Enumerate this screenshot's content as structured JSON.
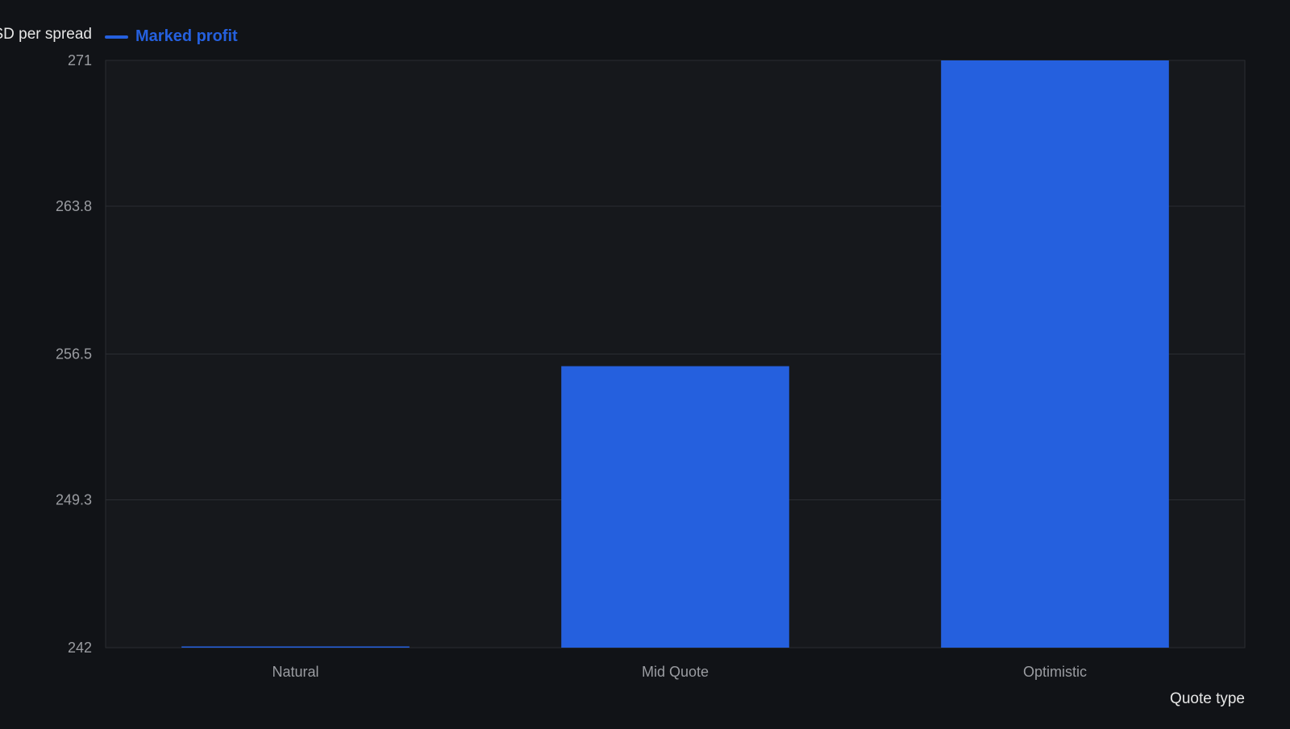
{
  "colors": {
    "background": "#111317",
    "plot_background": "#16181c",
    "bar": "#2560de",
    "grid": "#2a2d32",
    "axis_text": "#9a9ca1",
    "label_text": "#e6e6e6"
  },
  "chart_data": {
    "type": "bar",
    "ylabel": "USD per spread",
    "xlabel": "Quote type",
    "categories": [
      "Natural",
      "Mid Quote",
      "Optimistic"
    ],
    "series": [
      {
        "name": "Marked profit",
        "values": [
          242,
          255.9,
          271
        ]
      }
    ],
    "ylim": [
      242,
      271
    ],
    "yticks": [
      "242",
      "249.3",
      "256.5",
      "263.8",
      "271"
    ],
    "grid": true,
    "legend_position": "top-left"
  }
}
